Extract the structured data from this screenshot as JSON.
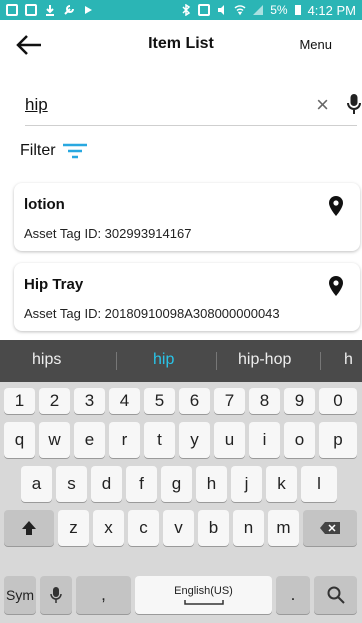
{
  "status_bar": {
    "time": "4:12 PM",
    "battery": "5%",
    "left_icons": [
      "gallery-icon",
      "image-icon",
      "download-icon",
      "wrench-icon",
      "play-icon"
    ],
    "right_icons": [
      "bluetooth-icon",
      "nfc-icon",
      "mute-icon",
      "wifi-icon",
      "signal-icon",
      "battery-icon"
    ]
  },
  "app_bar": {
    "title": "Item List",
    "menu_label": "Menu"
  },
  "search": {
    "value": "hip",
    "placeholder": ""
  },
  "filter": {
    "label": "Filter"
  },
  "items": [
    {
      "name": "lotion",
      "asset_tag": "Asset Tag ID: 302993914167"
    },
    {
      "name": "Hip Tray",
      "asset_tag": "Asset Tag ID: 20180910098A308000000043"
    }
  ],
  "suggestions": {
    "items": [
      "hips",
      "hip",
      "hip-hop",
      "h"
    ],
    "selected": "hip",
    "accent": "#29c4e8"
  },
  "keyboard": {
    "numbers": [
      "1",
      "2",
      "3",
      "4",
      "5",
      "6",
      "7",
      "8",
      "9",
      "0"
    ],
    "row1": [
      "q",
      "w",
      "e",
      "r",
      "t",
      "y",
      "u",
      "i",
      "o",
      "p"
    ],
    "row2": [
      "a",
      "s",
      "d",
      "f",
      "g",
      "h",
      "j",
      "k",
      "l"
    ],
    "row3": [
      "z",
      "x",
      "c",
      "v",
      "b",
      "n",
      "m"
    ],
    "sym_label": "Sym",
    "comma_label": ",",
    "space_label": "English(US)",
    "period_label": "."
  },
  "colors": {
    "status_bar": "#2bb5b5",
    "filter_icon": "#29a8e0",
    "suggest_bg": "#4a4a4a",
    "keyboard_bg": "#d8d8d8"
  }
}
